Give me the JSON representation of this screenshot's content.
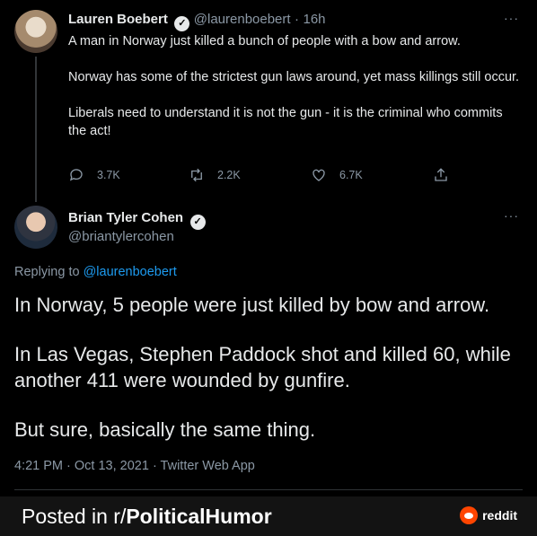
{
  "tweet1": {
    "name": "Lauren Boebert",
    "handle": "@laurenboebert",
    "time": "16h",
    "paragraphs": [
      "A man in Norway just killed a bunch of people with a bow and arrow.",
      "Norway has some of the strictest gun laws around, yet mass killings still occur.",
      "Liberals need to understand it is not the gun - it is the criminal who commits the act!"
    ],
    "replies": "3.7K",
    "retweets": "2.2K",
    "likes": "6.7K"
  },
  "tweet2": {
    "name": "Brian Tyler Cohen",
    "handle": "@briantylercohen",
    "replying_prefix": "Replying to",
    "replying_to": "@laurenboebert",
    "paragraphs": [
      "In Norway, 5 people were just killed by bow and arrow.",
      "In Las Vegas, Stephen Paddock shot and killed 60, while another 411 were wounded by gunfire.",
      "But sure, basically the same thing."
    ],
    "meta": "4:21 PM · Oct 13, 2021 · Twitter Web App"
  },
  "footer": {
    "posted_prefix": "Posted in r/",
    "subreddit": "PoliticalHumor",
    "brand": "reddit"
  },
  "more_glyph": "···",
  "verified_glyph": "✓",
  "colors": {
    "background": "#000000",
    "link": "#1d9bf0",
    "muted": "#8b98a5",
    "reddit": "#ff4500"
  }
}
